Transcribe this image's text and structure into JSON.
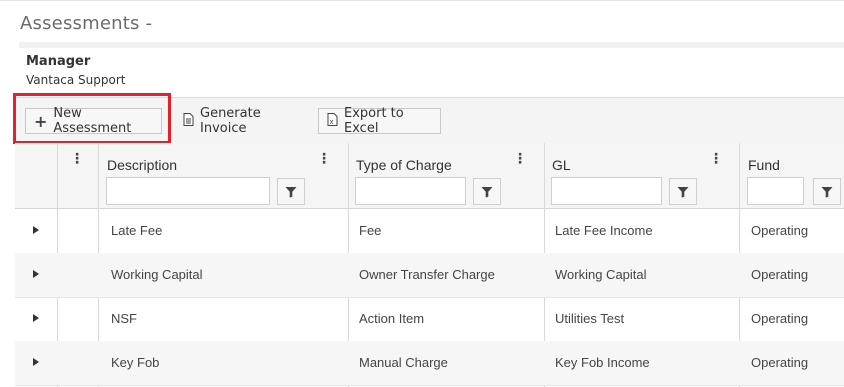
{
  "page": {
    "title": "Assessments -"
  },
  "manager": {
    "label": "Manager",
    "value": "Vantaca Support"
  },
  "toolbar": {
    "new_label": "New Assessment",
    "generate_label": "Generate Invoice",
    "export_label": "Export to Excel"
  },
  "colors": {
    "highlight": "#e8202a"
  },
  "grid": {
    "columns": [
      "Description",
      "Type of Charge",
      "GL",
      "Fund"
    ],
    "rows": [
      {
        "description": "Late Fee",
        "type": "Fee",
        "gl": "Late Fee Income",
        "fund": "Operating"
      },
      {
        "description": "Working Capital",
        "type": "Owner Transfer Charge",
        "gl": "Working Capital",
        "fund": "Operating"
      },
      {
        "description": "NSF",
        "type": "Action Item",
        "gl": "Utilities Test",
        "fund": "Operating"
      },
      {
        "description": "Key Fob",
        "type": "Manual Charge",
        "gl": "Key Fob Income",
        "fund": "Operating"
      }
    ]
  }
}
